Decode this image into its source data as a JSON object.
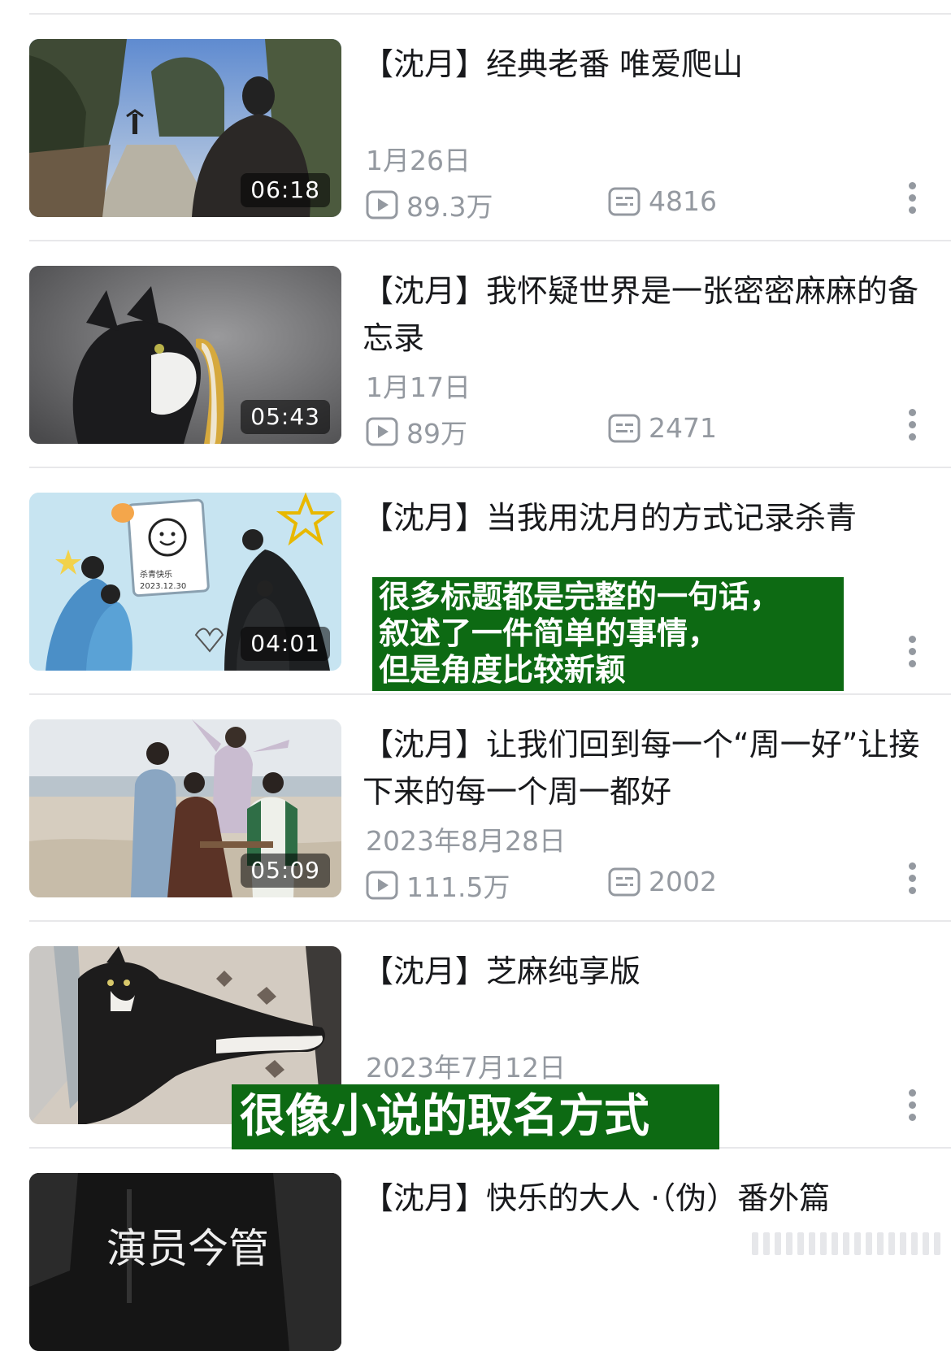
{
  "videos": [
    {
      "title": "【沈月】经典老番 唯爱爬山",
      "duration": "06:18",
      "date": "1月26日",
      "views": "89.3万",
      "danmaku": "4816"
    },
    {
      "title": "【沈月】我怀疑世界是一张密密麻麻的备忘录",
      "duration": "05:43",
      "date": "1月17日",
      "views": "89万",
      "danmaku": "2471"
    },
    {
      "title": "【沈月】当我用沈月的方式记录杀青",
      "duration": "04:01",
      "date": "",
      "views": "",
      "danmaku": ""
    },
    {
      "title": "【沈月】让我们回到每一个“周一好”让接下来的每一个周一都好",
      "duration": "05:09",
      "date": "2023年8月28日",
      "views": "111.5万",
      "danmaku": "2002"
    },
    {
      "title": "【沈月】芝麻纯享版",
      "duration": "",
      "date": "2023年7月12日",
      "views": "",
      "danmaku": ""
    },
    {
      "title": "【沈月】快乐的大人 ·（伪）番外篇",
      "duration": "",
      "date": "",
      "views": "",
      "danmaku": ""
    }
  ],
  "annotations": {
    "note1_lines": [
      "很多标题都是完整的一句话，",
      "叙述了一件简单的事情，",
      "但是角度比较新颖"
    ],
    "note2": "很像小说的取名方式"
  },
  "thumbnail_text": {
    "wrap_date": "2023.12.30",
    "wrap_label": "杀青快乐",
    "last_title_art": "演员今管"
  },
  "colors": {
    "overlay_green": "#0d6a13",
    "meta_gray": "#9499a0",
    "title_black": "#18191c",
    "divider": "#e8e8ea"
  },
  "icons": {
    "views": "play-count-icon",
    "danmaku": "danmaku-icon",
    "more": "more-vertical-icon"
  }
}
